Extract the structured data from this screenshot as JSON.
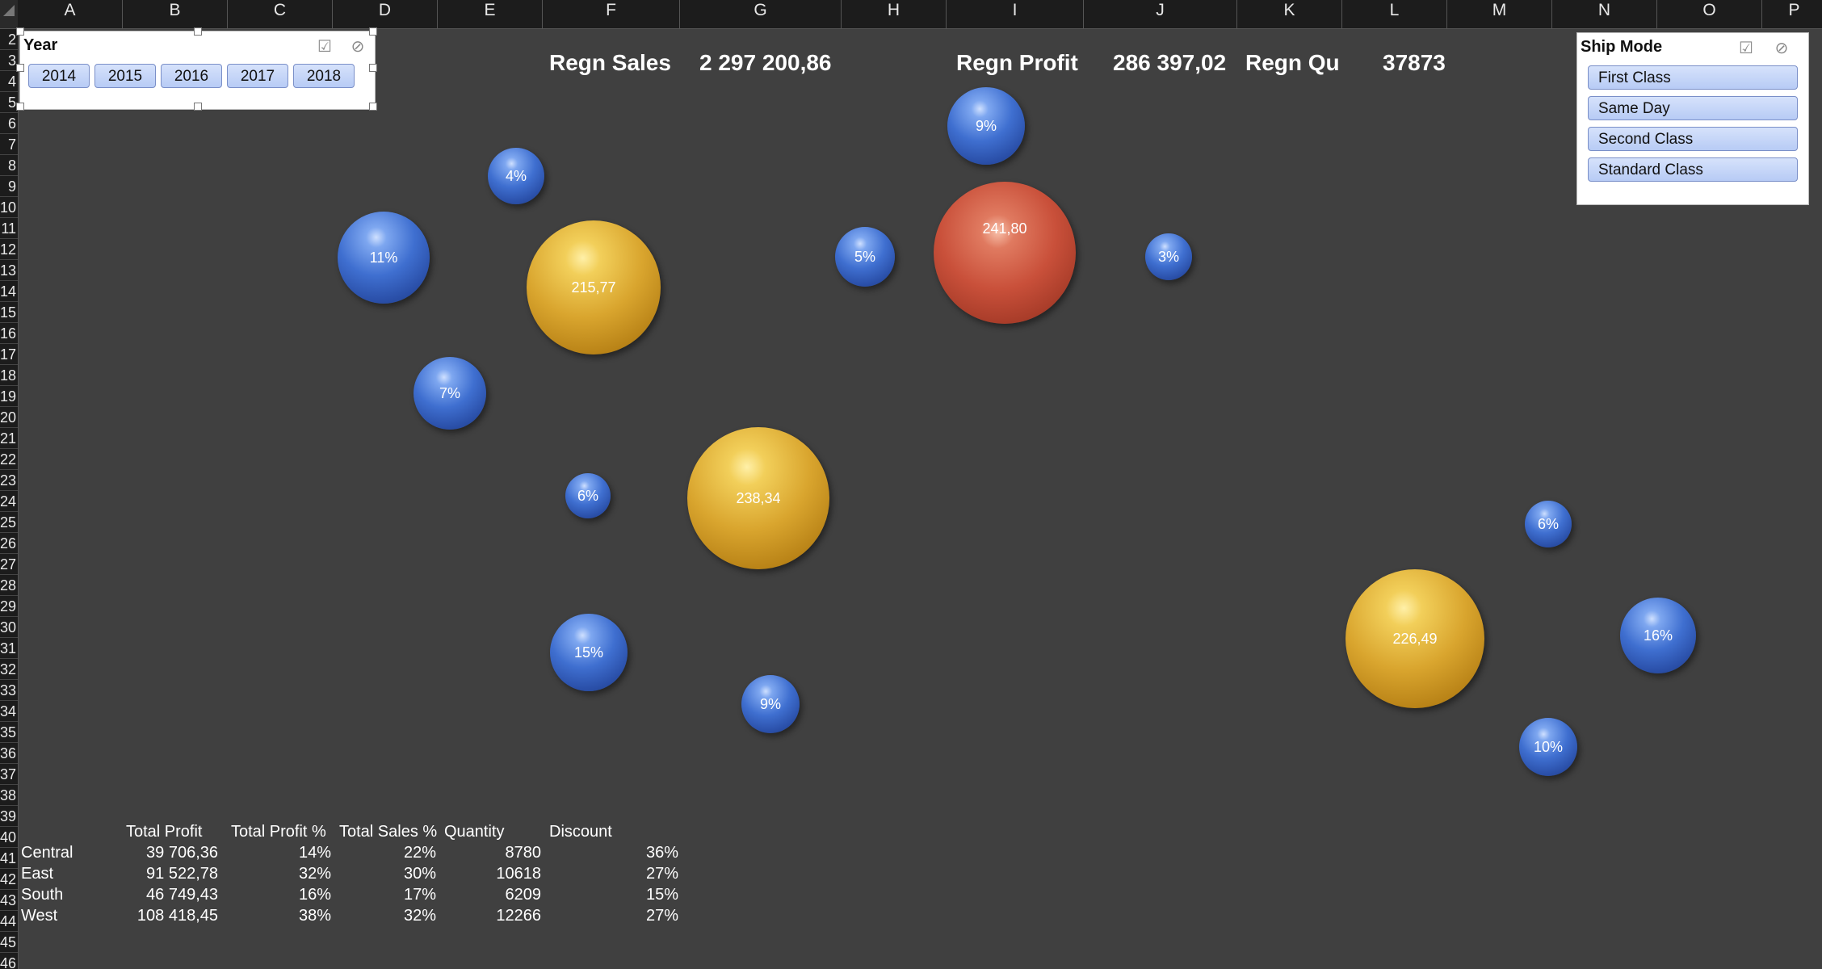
{
  "columns": [
    "A",
    "B",
    "C",
    "D",
    "E",
    "F",
    "G",
    "H",
    "I",
    "J",
    "K",
    "L",
    "M",
    "N",
    "O",
    "P"
  ],
  "rows": [
    "2",
    "3",
    "4",
    "5",
    "6",
    "7",
    "8",
    "9",
    "10",
    "11",
    "12",
    "13",
    "14",
    "15",
    "16",
    "17",
    "18",
    "19",
    "20",
    "21",
    "22",
    "23",
    "24",
    "25",
    "26",
    "27",
    "28",
    "29",
    "30",
    "31",
    "32",
    "33",
    "34",
    "35",
    "36",
    "37",
    "38",
    "39",
    "40",
    "41",
    "42",
    "43",
    "44",
    "45",
    "46"
  ],
  "year_slicer": {
    "title": "Year",
    "items": [
      "2014",
      "2015",
      "2016",
      "2017",
      "2018"
    ]
  },
  "ship_slicer": {
    "title": "Ship Mode",
    "items": [
      "First Class",
      "Same Day",
      "Second Class",
      "Standard Class"
    ]
  },
  "kpis": {
    "sales_label": "Regn Sales",
    "sales_value": "2 297 200,86",
    "profit_label": "Regn Profit",
    "profit_value": "286 397,02",
    "qty_label": "Regn Qu",
    "qty_value": "37873"
  },
  "bubbles": [
    {
      "label": "9%",
      "color": "blue"
    },
    {
      "label": "4%",
      "color": "blue"
    },
    {
      "label": "11%",
      "color": "blue"
    },
    {
      "label": "215,77",
      "color": "gold"
    },
    {
      "label": "5%",
      "color": "blue"
    },
    {
      "label": "241,80",
      "color": "red"
    },
    {
      "label": "3%",
      "color": "blue"
    },
    {
      "label": "7%",
      "color": "blue"
    },
    {
      "label": "6%",
      "color": "blue"
    },
    {
      "label": "238,34",
      "color": "gold"
    },
    {
      "label": "15%",
      "color": "blue"
    },
    {
      "label": "9%",
      "color": "blue"
    },
    {
      "label": "6%",
      "color": "blue"
    },
    {
      "label": "226,49",
      "color": "gold"
    },
    {
      "label": "16%",
      "color": "blue"
    },
    {
      "label": "10%",
      "color": "blue"
    }
  ],
  "table": {
    "headers": [
      "Total Profit",
      "Total Profit %",
      "Total Sales %",
      "Quantity",
      "Discount"
    ],
    "rows": [
      {
        "region": "Central",
        "profit": "39 706,36",
        "profit_pct": "14%",
        "sales_pct": "22%",
        "qty": "8780",
        "discount": "36%"
      },
      {
        "region": "East",
        "profit": "91 522,78",
        "profit_pct": "32%",
        "sales_pct": "30%",
        "qty": "10618",
        "discount": "27%"
      },
      {
        "region": "South",
        "profit": "46 749,43",
        "profit_pct": "16%",
        "sales_pct": "17%",
        "qty": "6209",
        "discount": "15%"
      },
      {
        "region": "West",
        "profit": "108 418,45",
        "profit_pct": "38%",
        "sales_pct": "32%",
        "qty": "12266",
        "discount": "27%"
      }
    ]
  }
}
